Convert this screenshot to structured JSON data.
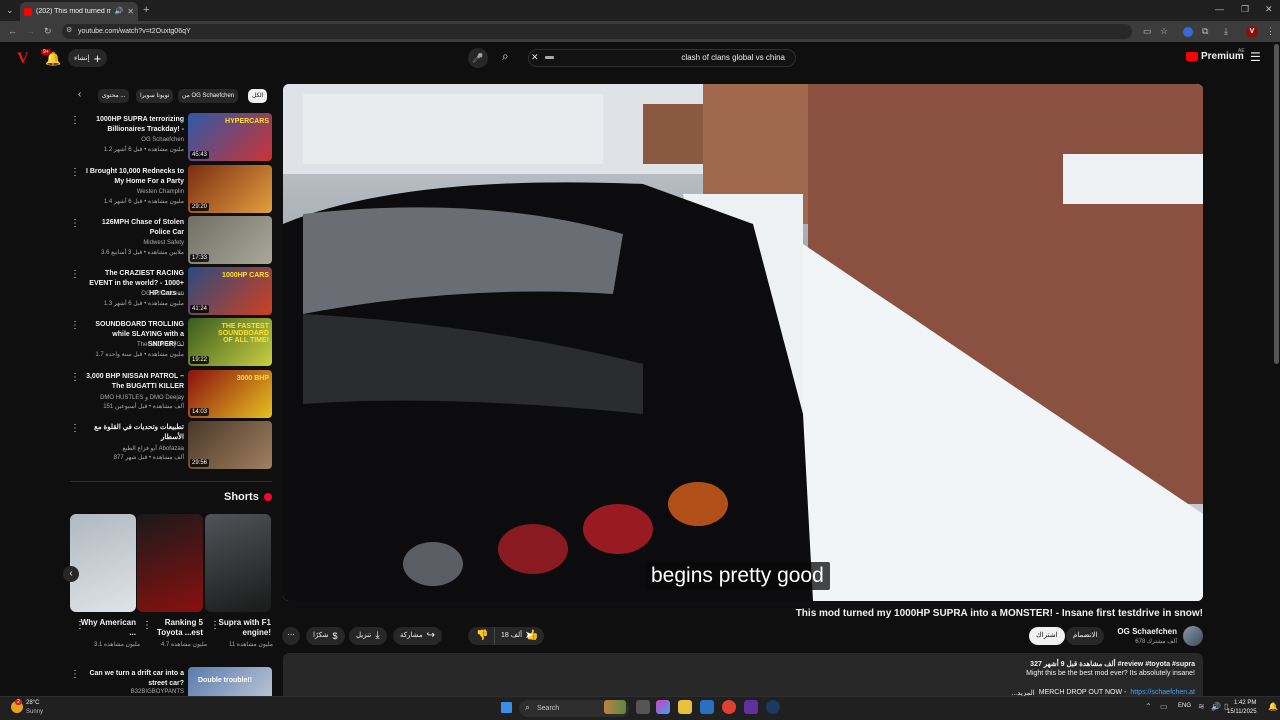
{
  "browser": {
    "tab_title": "(202) This mod turned my 1",
    "url": "youtube.com/watch?v=t2Ouxtg06qY"
  },
  "header": {
    "notification_count": "9+",
    "create_label": "إنشاء",
    "search_value": "clash of clans global vs china",
    "premium_label": "Premium",
    "country_code": "AE"
  },
  "chips": [
    "الكل",
    "من OG Schaefchen",
    "تويوتا سوبرا",
    "محتوى ..."
  ],
  "related": [
    {
      "title": "1000HP SUPRA terrorizing Billionaires Trackday! -",
      "channel": "OG Schaefchen",
      "meta": "1.2 مليون مشاهدة • قبل 6 أشهر",
      "duration": "45:43",
      "thumb_text": "HYPERCARS",
      "color1": "#2b5aa8",
      "color2": "#c33"
    },
    {
      "title": "I Brought 10,000 Rednecks to My Home For a Party",
      "channel": "Westen Champlin",
      "meta": "1.4 مليون مشاهدة • قبل 6 أشهر",
      "duration": "29:20",
      "thumb_text": "",
      "color1": "#7a2c10",
      "color2": "#e4a040"
    },
    {
      "title": "126MPH Chase of Stolen Police Car",
      "channel": "Midwest Safety",
      "meta": "3.6 ملايين مشاهدة • قبل 3 أسابيع",
      "duration": "17:33",
      "thumb_text": "",
      "color1": "#6f6f64",
      "color2": "#a9a89a"
    },
    {
      "title": "The CRAZIEST RACING EVENT in the world? - 1000+ HP Cars ...",
      "channel": "OG Schaefchen",
      "meta": "1.3 مليون مشاهدة • قبل 6 أشهر",
      "duration": "41:24",
      "thumb_text": "1000HP CARS",
      "color1": "#2a4c80",
      "color2": "#d04020"
    },
    {
      "title": "SOUNDBOARD TROLLING while SLAYING with a SNIPER! ...",
      "channel": "TheCallOfDutyGJ",
      "meta": "1.7 مليون مشاهدة • قبل سنة واحدة",
      "duration": "19:22",
      "thumb_text": "THE FASTEST SOUNDBOARD OF ALL TIME!",
      "color1": "#3a5a20",
      "color2": "#c8d040"
    },
    {
      "title": "3,000 BHP NISSAN PATROL – The BUGATTI KILLER",
      "channel": "DMO HUSTLES و DMO Deejay",
      "meta": "151 ألف مشاهدة • قبل أسبوعين",
      "duration": "14:03",
      "thumb_text": "3000 BHP",
      "color1": "#8a1010",
      "color2": "#e8c020"
    },
    {
      "title": "تطبيعات وتحديات في القلوة مع الأسطار",
      "channel": "أبو فزاع الطيع Abofazaa",
      "meta": "877 ألف مشاهدة • قبل شهر",
      "duration": "29:56",
      "thumb_text": "",
      "color1": "#4a3828",
      "color2": "#a08060"
    }
  ],
  "shorts": {
    "heading": "Shorts",
    "items": [
      {
        "title": "Supra with F1 engine!",
        "views": "11 مليون مشاهدة",
        "color1": "#505458",
        "color2": "#1a1a1a"
      },
      {
        "title": "Ranking 5 Toyota ...est",
        "views": "4.7 مليون مشاهدة",
        "color1": "#1a1a1a",
        "color2": "#8a1010"
      },
      {
        "title": "Why American ...",
        "views": "3.1 مليون مشاهدة",
        "color1": "#b0b8c0",
        "color2": "#e0e4e8"
      }
    ]
  },
  "next_item": {
    "title": "Can we turn a drift car into a street car?",
    "channel": "B32BIGBOYPANTS",
    "thumb_text": "Double trouble!!"
  },
  "video": {
    "caption": "begins pretty good",
    "title": "This mod turned my 1000HP SUPRA into a MONSTER! - Insane first testdrive in snow!",
    "channel": "OG Schaefchen",
    "subscribers": "678 ألف مشترك",
    "join_label": "الانضمام",
    "subscribe_label": "اشتراك",
    "likes": "18 ألف",
    "share_label": "مشاركة",
    "download_label": "تنزيل",
    "thanks_label": "شكرًا",
    "description_meta": "327 ألف مشاهدة قبل 9 أشهر  #review #toyota #supra",
    "description_line": "Might this be the best mod ever? Its absolutely insane!",
    "description_link_prefix": "MERCH DROP OUT NOW -",
    "description_link": "https://schaefchen.at",
    "description_more": "...المزيد"
  },
  "taskbar": {
    "temperature": "28°C",
    "weather": "Sunny",
    "search_placeholder": "Search",
    "language": "ENG",
    "time": "1:42 PM",
    "date": "15/11/2025",
    "weather_badge": "2"
  },
  "colors": {
    "accent": "#ff0000",
    "link": "#3ea6ff",
    "bg": "#0f0f0f"
  }
}
